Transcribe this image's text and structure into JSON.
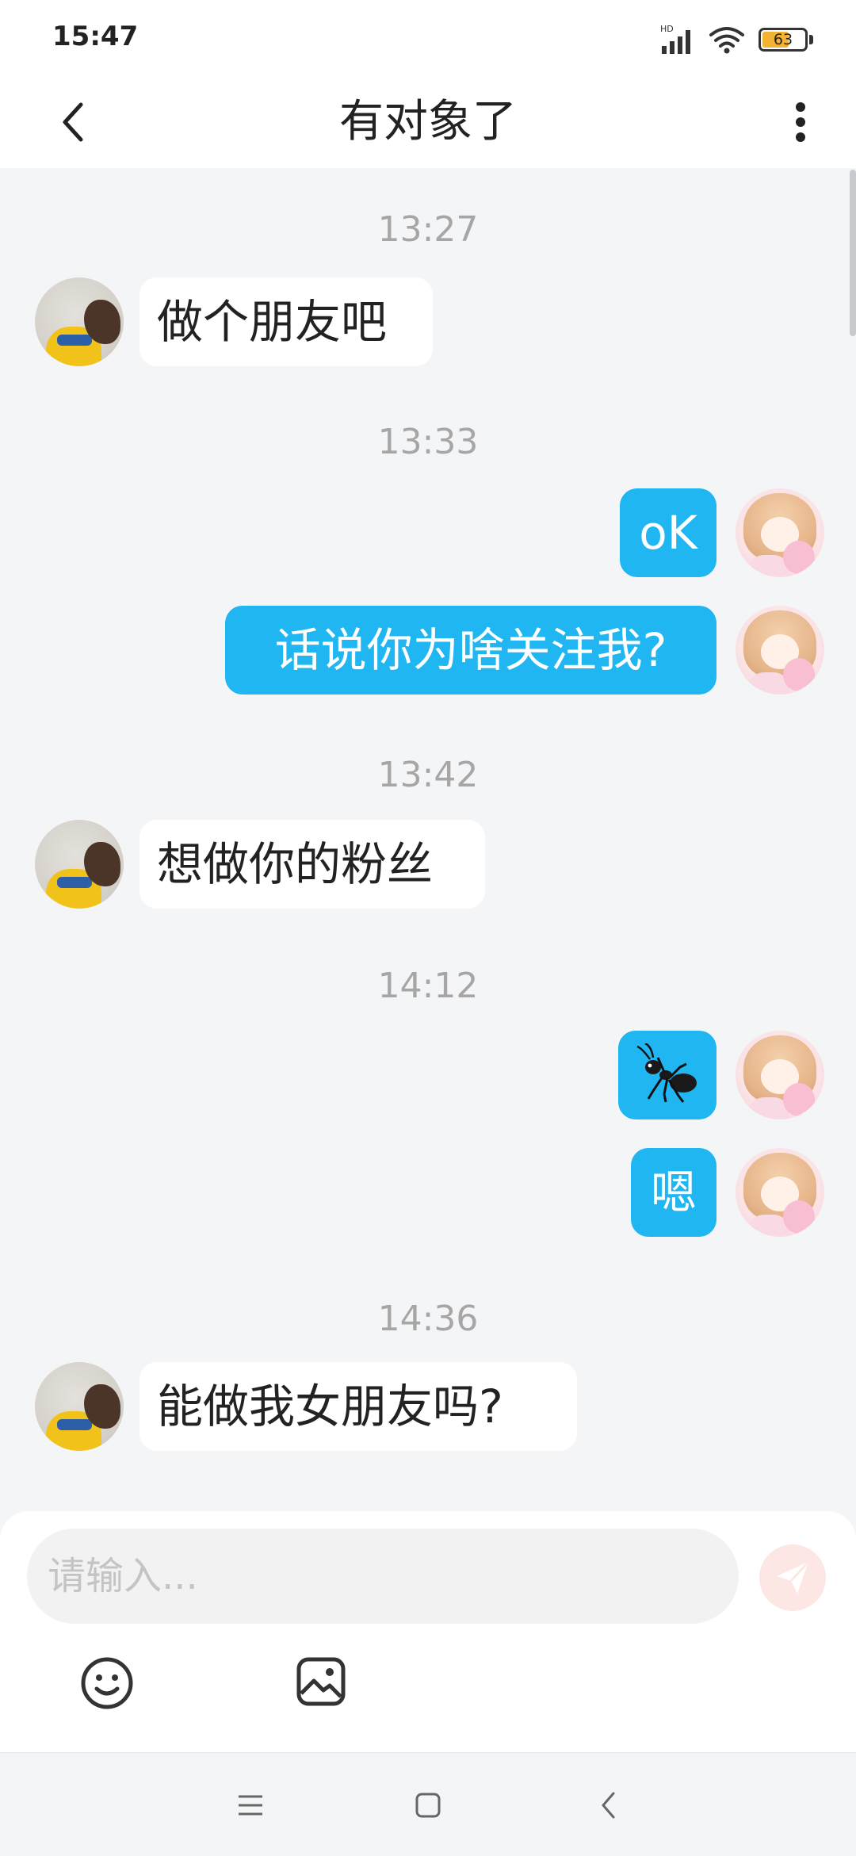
{
  "status_bar": {
    "time": "15:47",
    "network_badge": "HD",
    "battery_level": 63,
    "battery_text": "63"
  },
  "header": {
    "title": "有对象了",
    "back_icon": "chevron-left-icon",
    "more_icon": "vertical-dots-icon"
  },
  "messages": [
    {
      "timestamp": "13:27"
    },
    {
      "sender": "them",
      "text": "做个朋友吧"
    },
    {
      "timestamp": "13:33"
    },
    {
      "sender": "me",
      "text": "oK"
    },
    {
      "sender": "me",
      "text": "话说你为啥关注我?"
    },
    {
      "timestamp": "13:42"
    },
    {
      "sender": "them",
      "text": "想做你的粉丝"
    },
    {
      "timestamp": "14:12"
    },
    {
      "sender": "me",
      "emoji": "ant-emoji"
    },
    {
      "sender": "me",
      "text": "嗯"
    },
    {
      "timestamp": "14:36"
    },
    {
      "sender": "them",
      "text": "能做我女朋友吗?"
    }
  ],
  "composer": {
    "placeholder": "请输入...",
    "value": "",
    "send_icon": "paper-plane-icon",
    "emoji_icon": "smiley-icon",
    "image_icon": "image-icon"
  },
  "navigation": {
    "menu_icon": "menu-lines-icon",
    "home_icon": "square-icon",
    "back_icon": "chevron-left-icon"
  },
  "colors": {
    "outgoing_bubble": "#1fb6f2",
    "incoming_bubble": "#ffffff",
    "chat_background": "#f4f5f7",
    "send_button": "#fde7e5"
  }
}
